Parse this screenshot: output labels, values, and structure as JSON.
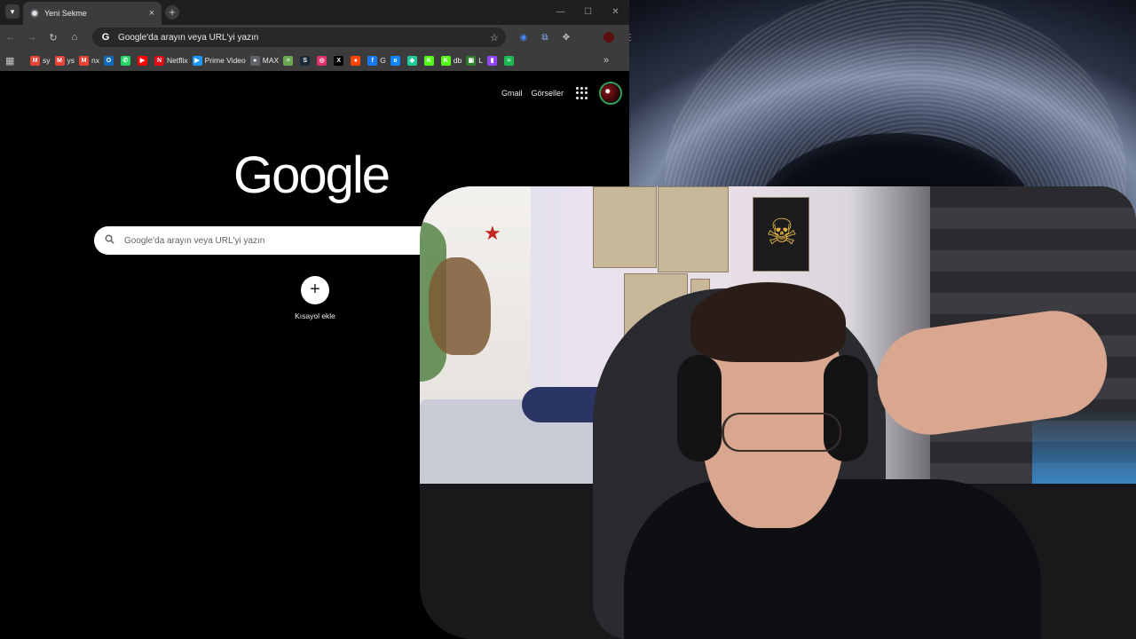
{
  "tab": {
    "title": "Yeni Sekme",
    "close": "×",
    "new": "+"
  },
  "window_controls": {
    "minimize": "—",
    "maximize": "☐",
    "close": "✕"
  },
  "nav": {
    "back": "←",
    "forward": "→",
    "reload": "↻",
    "home": "⌂"
  },
  "omnibox": {
    "text": "Google'da arayın veya URL'yi yazın",
    "g": "G",
    "star": "☆"
  },
  "bookmarks": [
    {
      "name": "bm-gmail-sy",
      "label": "sy",
      "icon": "M",
      "color": "#ea4335"
    },
    {
      "name": "bm-gmail-ys",
      "label": "ys",
      "icon": "M",
      "color": "#ea4335"
    },
    {
      "name": "bm-gmail-nx",
      "label": "nx",
      "icon": "M",
      "color": "#ea4335"
    },
    {
      "name": "bm-outlook",
      "label": "",
      "icon": "O",
      "color": "#0f6cbd"
    },
    {
      "name": "bm-whatsapp",
      "label": "",
      "icon": "✆",
      "color": "#25d366"
    },
    {
      "name": "bm-youtube",
      "label": "",
      "icon": "▶",
      "color": "#ff0000"
    },
    {
      "name": "bm-netflix",
      "label": "Netflix",
      "icon": "N",
      "color": "#e50914"
    },
    {
      "name": "bm-prime",
      "label": "Prime Video",
      "icon": "▶",
      "color": "#1a98ff"
    },
    {
      "name": "bm-max",
      "label": "MAX",
      "icon": "●",
      "color": "#5f6368"
    },
    {
      "name": "bm-ext1",
      "label": "",
      "icon": "≡",
      "color": "#6aa84f"
    },
    {
      "name": "bm-steam",
      "label": "",
      "icon": "S",
      "color": "#1b2838"
    },
    {
      "name": "bm-instagram",
      "label": "",
      "icon": "◎",
      "color": "#e1306c"
    },
    {
      "name": "bm-x",
      "label": "",
      "icon": "X",
      "color": "#000000"
    },
    {
      "name": "bm-reddit",
      "label": "",
      "icon": "●",
      "color": "#ff4500"
    },
    {
      "name": "bm-facebook",
      "label": "G",
      "icon": "f",
      "color": "#1877f2"
    },
    {
      "name": "bm-bluesky",
      "label": "",
      "icon": "ʚ",
      "color": "#1185fe"
    },
    {
      "name": "bm-ext2",
      "label": "",
      "icon": "◆",
      "color": "#20c997"
    },
    {
      "name": "bm-kick1",
      "label": "",
      "icon": "K",
      "color": "#53fc18"
    },
    {
      "name": "bm-kick-db",
      "label": "db",
      "icon": "K",
      "color": "#53fc18"
    },
    {
      "name": "bm-terminal",
      "label": "L",
      "icon": "▣",
      "color": "#2d7d2d"
    },
    {
      "name": "bm-twitch",
      "label": "",
      "icon": "▮",
      "color": "#9146ff"
    },
    {
      "name": "bm-spotify",
      "label": "",
      "icon": "≈",
      "color": "#1db954"
    }
  ],
  "bookmarks_more": "»",
  "page": {
    "gmail": "Gmail",
    "images": "Görseller",
    "logo": "Google",
    "search_placeholder": "Google'da arayın veya URL'yi yazın",
    "shortcut_plus": "+",
    "shortcut_label": "Kısayol ekle"
  }
}
